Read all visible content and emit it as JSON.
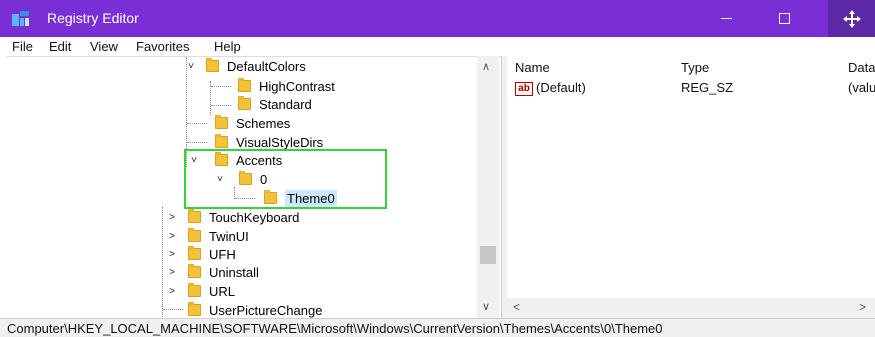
{
  "window": {
    "title": "Registry Editor",
    "accent": "#7a2fd6"
  },
  "menu": [
    "File",
    "Edit",
    "View",
    "Favorites",
    "Help"
  ],
  "tree": {
    "nodes": [
      {
        "label": "DefaultColors",
        "expander": "expanded"
      },
      {
        "label": "HighContrast",
        "expander": "none"
      },
      {
        "label": "Standard",
        "expander": "none"
      },
      {
        "label": "Schemes",
        "expander": "none"
      },
      {
        "label": "VisualStyleDirs",
        "expander": "none"
      },
      {
        "label": "Accents",
        "expander": "expanded"
      },
      {
        "label": "0",
        "expander": "expanded"
      },
      {
        "label": "Theme0",
        "expander": "none",
        "selected": true
      },
      {
        "label": "TouchKeyboard",
        "expander": "collapsed"
      },
      {
        "label": "TwinUI",
        "expander": "collapsed"
      },
      {
        "label": "UFH",
        "expander": "collapsed"
      },
      {
        "label": "Uninstall",
        "expander": "collapsed"
      },
      {
        "label": "URL",
        "expander": "collapsed"
      },
      {
        "label": "UserPictureChange",
        "expander": "none"
      }
    ],
    "highlight_color": "#35d335"
  },
  "values_pane": {
    "columns": [
      "Name",
      "Type",
      "Data"
    ],
    "rows": [
      {
        "name": "(Default)",
        "type": "REG_SZ",
        "data": "(valu",
        "icon": "ab-string-icon"
      }
    ]
  },
  "status": {
    "path": "Computer\\HKEY_LOCAL_MACHINE\\SOFTWARE\\Microsoft\\Windows\\CurrentVersion\\Themes\\Accents\\0\\Theme0"
  }
}
